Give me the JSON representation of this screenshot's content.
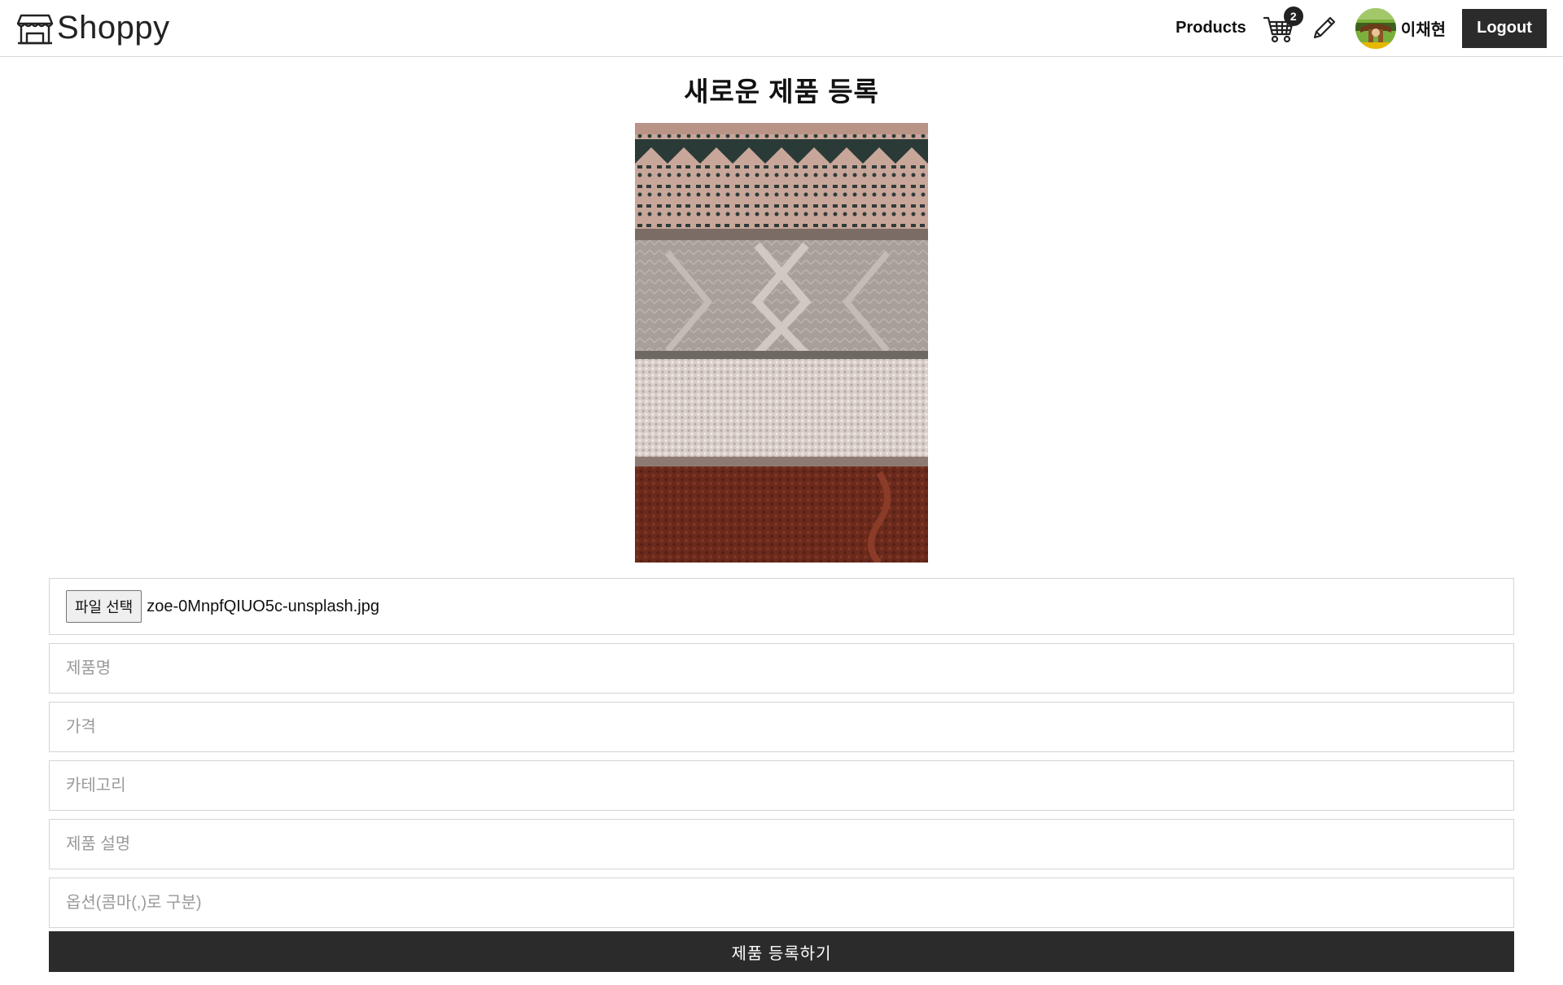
{
  "header": {
    "logo_text": "Shoppy",
    "nav_products": "Products",
    "cart_count": "2",
    "user_name": "이채현",
    "logout_label": "Logout"
  },
  "page": {
    "title": "새로운 제품 등록"
  },
  "form": {
    "file_button_label": "파일 선택",
    "file_name": "zoe-0MnpfQIUO5c-unsplash.jpg",
    "name_placeholder": "제품명",
    "price_placeholder": "가격",
    "category_placeholder": "카테고리",
    "description_placeholder": "제품 설명",
    "options_placeholder": "옵션(콤마(,)로 구분)",
    "submit_label": "제품 등록하기"
  },
  "colors": {
    "dark_button": "#2b2b2b",
    "border": "#d4d4d4",
    "placeholder": "#9a9a9a"
  },
  "icons": {
    "logo": "storefront-icon",
    "cart": "shopping-cart-icon",
    "edit": "pencil-icon"
  }
}
